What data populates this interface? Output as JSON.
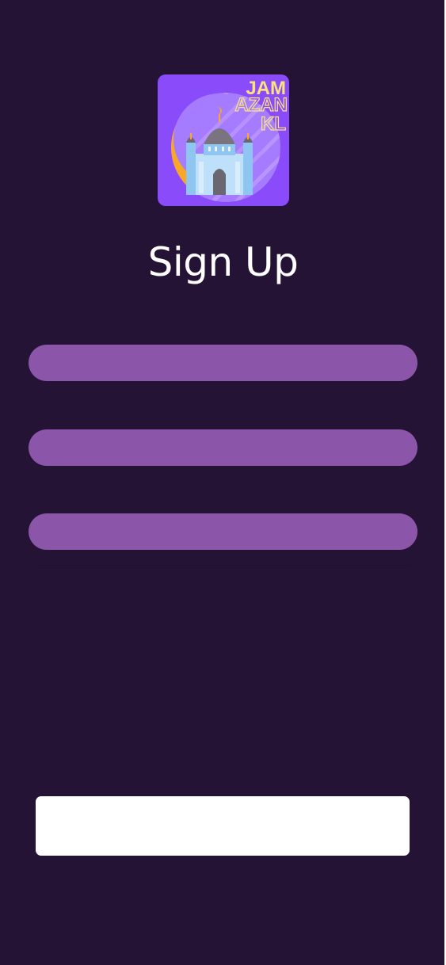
{
  "app": {
    "logo_text": [
      "JAM",
      "AZAN",
      "KL"
    ],
    "logo_colors": {
      "background": "#8a4cfb",
      "crescent": "#f9a825",
      "text": "#fbe27d"
    }
  },
  "page": {
    "title": "Sign Up"
  },
  "form": {
    "fields": [
      {
        "value": "",
        "placeholder": ""
      },
      {
        "value": "",
        "placeholder": ""
      },
      {
        "value": "",
        "placeholder": ""
      }
    ],
    "submit_label": ""
  },
  "colors": {
    "background": "#251335",
    "field": "#8b56aa",
    "button": "#ffffff",
    "title": "#ffffff"
  }
}
